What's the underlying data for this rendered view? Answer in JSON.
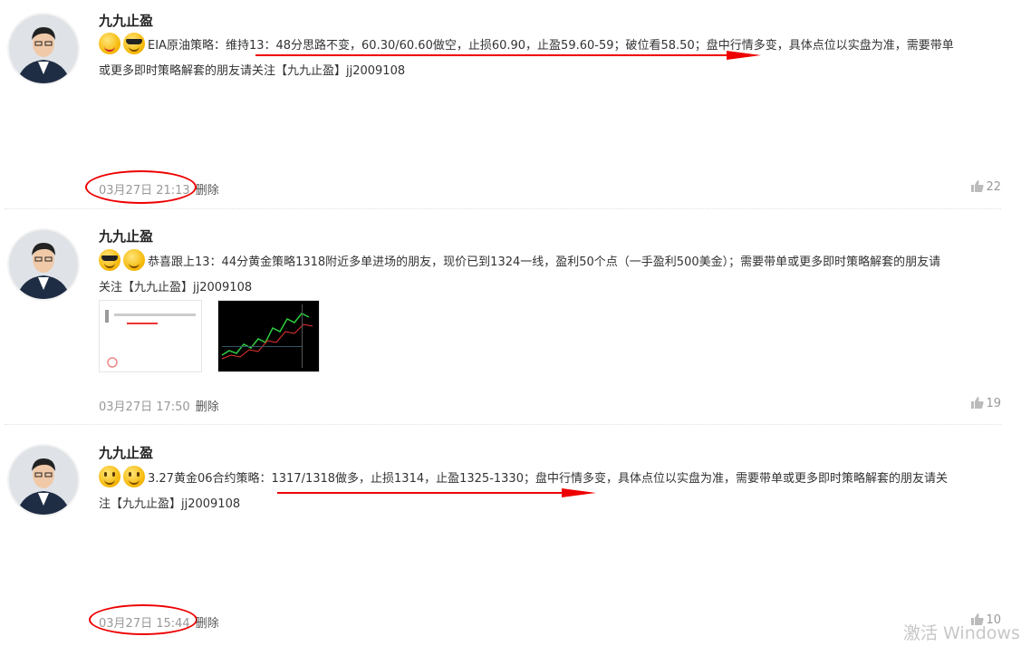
{
  "posts": [
    {
      "author": "九九止盈",
      "emojis": [
        "tongue-emoji",
        "sunglasses-emoji"
      ],
      "text_line1": "EIA原油策略：维持13：48分思路不变，60.30/60.60做空，止损60.90，止盈59.60-59；破位看58.50；盘中行情多变，具体点位以实盘为准，需要带单",
      "text_line2": "或更多即时策略解套的朋友请关注【九九止盈】jj2009108",
      "time": "03月27日 21:13",
      "delete_label": "删除",
      "likes": "22"
    },
    {
      "author": "九九止盈",
      "emojis": [
        "sunglasses-emoji",
        "hand-over-mouth-emoji"
      ],
      "text_line1": "恭喜跟上13：44分黄金策略1318附近多单进场的朋友，现价已到1324一线，盈利50个点（一手盈利500美金）；需要带单或更多即时策略解套的朋友请",
      "text_line2": "关注【九九止盈】jj2009108",
      "time": "03月27日 17:50",
      "delete_label": "删除",
      "likes": "19"
    },
    {
      "author": "九九止盈",
      "emojis": [
        "smile-emoji",
        "smile-emoji"
      ],
      "text_line1": "3.27黄金06合约策略：1317/1318做多，止损1314，止盈1325-1330；盘中行情多变，具体点位以实盘为准，需要带单或更多即时策略解套的朋友请关",
      "text_line2": "注【九九止盈】jj2009108",
      "time": "03月27日 15:44",
      "delete_label": "删除",
      "likes": "10"
    }
  ],
  "watermark": "激活 Windows",
  "colors": {
    "annotation": "#e00000",
    "meta": "#999999"
  }
}
